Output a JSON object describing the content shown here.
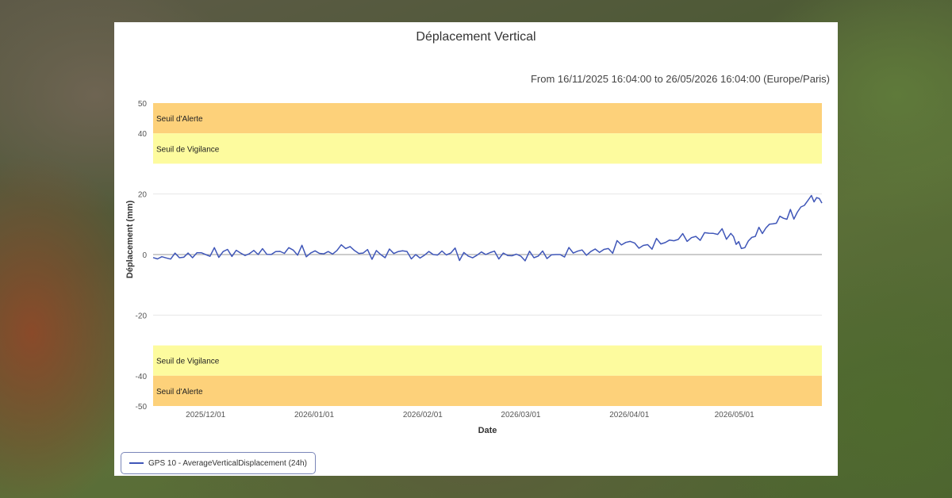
{
  "chart_data": {
    "type": "line",
    "title": "Déplacement Vertical",
    "subtitle": "From 16/11/2025 16:04:00 to 26/05/2026 16:04:00 (Europe/Paris)",
    "xlabel": "Date",
    "ylabel": "Déplacement (mm)",
    "ylim": [
      -50,
      50
    ],
    "xlim": [
      "2025-11-16",
      "2026-05-26"
    ],
    "yticks": [
      50,
      40,
      20,
      0,
      -20,
      -40,
      -50
    ],
    "xticks": [
      "2025/12/01",
      "2026/01/01",
      "2026/02/01",
      "2026/03/01",
      "2026/04/01",
      "2026/05/01"
    ],
    "grid": true,
    "legend_position": "bottom-left",
    "bands": [
      {
        "label": "Seuil d'Alerte",
        "from": 40,
        "to": 50,
        "color": "#fdd17a"
      },
      {
        "label": "Seuil de Vigilance",
        "from": 30,
        "to": 40,
        "color": "#fdfb9e"
      },
      {
        "label": "Seuil de Vigilance",
        "from": -40,
        "to": -30,
        "color": "#fdfb9e"
      },
      {
        "label": "Seuil d'Alerte",
        "from": -50,
        "to": -40,
        "color": "#fdd17a"
      }
    ],
    "series": [
      {
        "name": "GPS 10 - AverageVerticalDisplacement (24h)",
        "color": "#3f56b8",
        "x": [
          "2025-11-16",
          "2025-11-21",
          "2025-11-26",
          "2025-12-01",
          "2025-12-06",
          "2025-12-11",
          "2025-12-16",
          "2025-12-21",
          "2025-12-26",
          "2025-12-31",
          "2026-01-05",
          "2026-01-10",
          "2026-01-15",
          "2026-01-20",
          "2026-01-25",
          "2026-01-30",
          "2026-02-04",
          "2026-02-09",
          "2026-02-14",
          "2026-02-19",
          "2026-02-24",
          "2026-03-01",
          "2026-03-06",
          "2026-03-11",
          "2026-03-16",
          "2026-03-21",
          "2026-03-26",
          "2026-03-31",
          "2026-04-05",
          "2026-04-10",
          "2026-04-15",
          "2026-04-20",
          "2026-04-25",
          "2026-04-30",
          "2026-05-03",
          "2026-05-07",
          "2026-05-11",
          "2026-05-15",
          "2026-05-19",
          "2026-05-23",
          "2026-05-26"
        ],
        "y": [
          -1,
          -1.5,
          0.5,
          0,
          1,
          0.5,
          0,
          1,
          1.5,
          0.5,
          1,
          2,
          0.5,
          0,
          1,
          0,
          0,
          0.5,
          -0.5,
          0,
          0.5,
          -0.5,
          -0.5,
          0,
          0.5,
          1,
          2,
          4,
          3,
          3.5,
          5,
          6,
          7,
          7,
          2,
          6,
          10,
          12,
          14,
          19.5,
          17
        ]
      }
    ]
  },
  "legend": {
    "label": "GPS 10 - AverageVerticalDisplacement (24h)"
  }
}
